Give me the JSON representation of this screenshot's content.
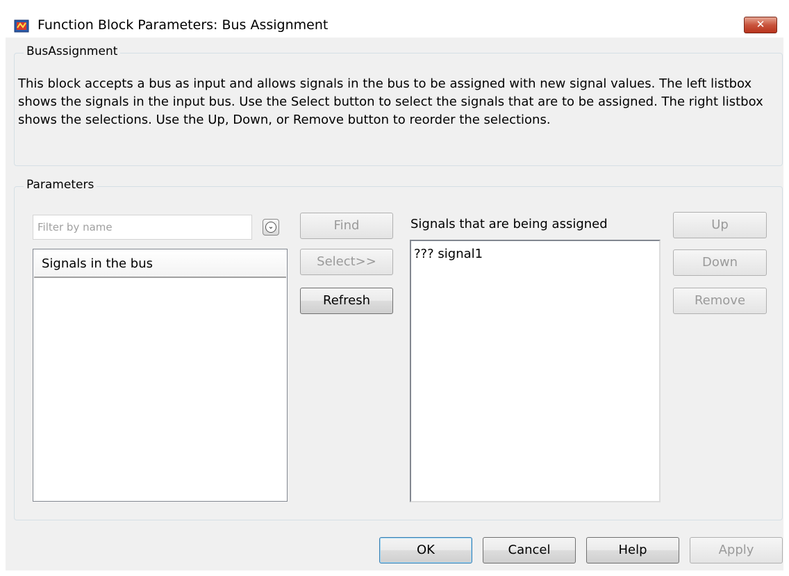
{
  "window": {
    "title": "Function Block Parameters: Bus Assignment",
    "close_icon": "close-icon",
    "app_icon": "simulink-block-icon"
  },
  "block_group": {
    "legend": "BusAssignment",
    "description": "This block accepts a bus as input and allows signals in the bus to be assigned with new signal values. The left listbox shows the signals in the input bus. Use the Select button to select the signals that are to be assigned. The right listbox shows the selections. Use the Up, Down, or Remove button to reorder the selections."
  },
  "parameters_group": {
    "legend": "Parameters",
    "filter": {
      "placeholder": "Filter by name",
      "value": ""
    },
    "find_label": "Find",
    "select_label": "Select>>",
    "refresh_label": "Refresh",
    "signals_in_bus_header": "Signals in the bus",
    "assigned_label": "Signals that are being assigned",
    "assigned_items": [
      "??? signal1"
    ],
    "up_label": "Up",
    "down_label": "Down",
    "remove_label": "Remove"
  },
  "footer": {
    "ok_label": "OK",
    "cancel_label": "Cancel",
    "help_label": "Help",
    "apply_label": "Apply"
  }
}
